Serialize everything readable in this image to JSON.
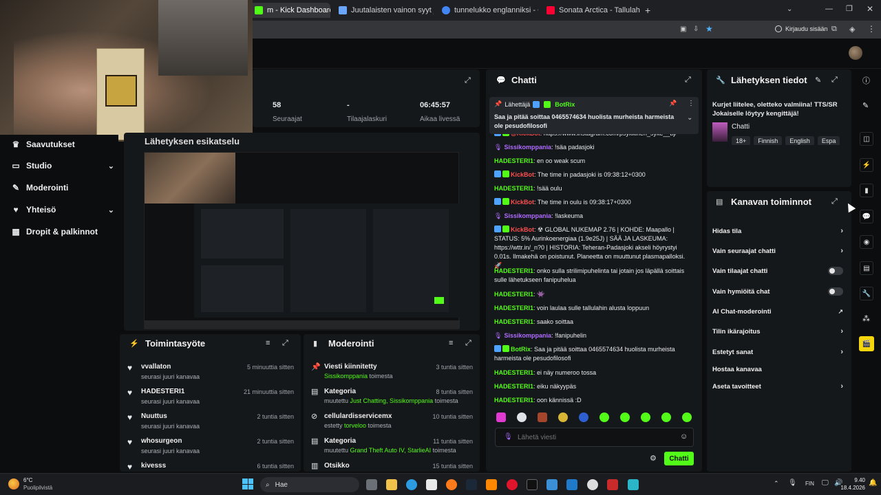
{
  "browser": {
    "tabs": [
      {
        "label": "m - Kick Dashboard",
        "color": "#53fc18"
      },
      {
        "label": "Juutalaisten vainon syyt ja aikaj",
        "color": "#6aa5ff"
      },
      {
        "label": "tunnelukko englanniksi - Googl",
        "color": "#4285f4"
      },
      {
        "label": "Sonata Arctica - Tallulah - YouT",
        "color": "#ff0033"
      }
    ],
    "signin_label": "Kirjaudu sisään"
  },
  "stats": [
    {
      "value": "58",
      "label": "Seuraajat"
    },
    {
      "value": "-",
      "label": "Tilaajalaskuri"
    },
    {
      "value": "06:45:57",
      "label": "Aikaa livessä"
    }
  ],
  "sidebar": {
    "items": [
      {
        "label": "Saavutukset",
        "icon": "trophy-icon"
      },
      {
        "label": "Studio",
        "icon": "studio-icon"
      },
      {
        "label": "Moderointi",
        "icon": "wrench-icon"
      },
      {
        "label": "Yhteisö",
        "icon": "community-icon"
      },
      {
        "label": "Dropit & palkinnot",
        "icon": "gift-icon"
      }
    ]
  },
  "preview": {
    "title": "Lähetyksen esikatselu"
  },
  "activity": {
    "title": "Toimintasyöte",
    "items": [
      {
        "name": "vvallaton",
        "sub": "seurasi juuri kanavaa",
        "time": "5 minuuttia sitten"
      },
      {
        "name": "HADESTERI1",
        "sub": "seurasi juuri kanavaa",
        "time": "21 minuuttia sitten"
      },
      {
        "name": "Nuuttus",
        "sub": "seurasi juuri kanavaa",
        "time": "2 tuntia sitten"
      },
      {
        "name": "whosurgeon",
        "sub": "seurasi juuri kanavaa",
        "time": "2 tuntia sitten"
      },
      {
        "name": "kivesss",
        "sub": "",
        "time": "6 tuntia sitten"
      }
    ]
  },
  "moderation": {
    "title": "Moderointi",
    "items": [
      {
        "name": "Viesti kiinnitetty",
        "sub_pre": "",
        "highlight": "Sissikomppania",
        "sub_post": " toimesta",
        "time": "3 tuntia sitten"
      },
      {
        "name": "Kategoria",
        "sub_pre": "muutettu ",
        "highlight": "Just Chatting, Sissikomppania",
        "sub_post": " toimesta",
        "time": "8 tuntia sitten"
      },
      {
        "name": "cellulardisservicemx",
        "sub_pre": "estetty ",
        "highlight": "torveloo",
        "sub_post": " toimesta",
        "time": "10 tuntia sitten"
      },
      {
        "name": "Kategoria",
        "sub_pre": "muutettu ",
        "highlight": "Grand Theft Auto IV, StarlieAI",
        "sub_post": " toimesta",
        "time": "11 tuntia sitten"
      },
      {
        "name": "Otsikko",
        "sub_pre": "",
        "highlight": "",
        "sub_post": "",
        "time": "15 tuntia sitten"
      }
    ]
  },
  "chat": {
    "title": "Chatti",
    "pinned_label": "Lähettäjä",
    "pinned_user": "BotRix",
    "pinned_text": "Saa ja pitää soittaa 0465574634 huolista murheista harmeista ole pesudofilosofi",
    "input_placeholder": "Lähetä viesti",
    "send_label": "Chatti",
    "messages": [
      {
        "user": "@KickBot",
        "cls": "red",
        "text": "https://www.instagram.com/psykkinen_syke__bj/"
      },
      {
        "user": "Sissikomppania",
        "cls": "purple",
        "text": "!säa padasjoki"
      },
      {
        "user": "HADESTERI1",
        "cls": "",
        "text": "en oo weak scum"
      },
      {
        "user": "KickBot",
        "cls": "red",
        "text": "The time in padasjoki is 09:38:12+0300"
      },
      {
        "user": "HADESTERI1",
        "cls": "",
        "text": "!sää oulu"
      },
      {
        "user": "KickBot",
        "cls": "red",
        "text": "The time in oulu is 09:38:17+0300"
      },
      {
        "user": "Sissikomppania",
        "cls": "purple",
        "text": "!laskeuma"
      },
      {
        "user": "KickBot",
        "cls": "red",
        "text": "☢ GLOBAL NUKEMAP 2.76 | KOHDE: Maapallo | STATUS: 5% Aurinkoenergiaa (1.9e25J) | SÄÄ JA LASKEUMA: https://wttr.in/_n?0 | HISTORIA: Teheran-Padasjoki akseli höyrystyi 0.01s. Ilmakehä on poistunut. Planeetta on muuttunut plasmapalloksi. 🚀"
      },
      {
        "user": "HADESTERI1",
        "cls": "",
        "text": "onko sulla strilimipuhelinta tai jotain jos läpällä soittais sulle lähetukseen fanipuhelua"
      },
      {
        "user": "HADESTERI1",
        "cls": "",
        "text": "👾"
      },
      {
        "user": "HADESTERI1",
        "cls": "",
        "text": "voin laulaa sulle tallulahin alusta loppuun"
      },
      {
        "user": "HADESTERI1",
        "cls": "",
        "text": "saako soittaa"
      },
      {
        "user": "Sissikomppania",
        "cls": "purple",
        "text": "!fanipuhelin"
      },
      {
        "user": "BotRix",
        "cls": "",
        "text": "Saa ja pitää soittaa 0465574634 huolista murheista harmeista ole pesudofilosofi"
      },
      {
        "user": "HADESTERI1",
        "cls": "",
        "text": "ei näy numeroo tossa"
      },
      {
        "user": "HADESTERI1",
        "cls": "",
        "text": "eiku näkyypäs"
      },
      {
        "user": "HADESTERI1",
        "cls": "",
        "text": "oon kännissä :D"
      }
    ]
  },
  "stream_info": {
    "title": "Lähetyksen tiedot",
    "description": "Kurjet liitelee, oletteko valmiina! TTS/SR Jokaiselle löytyy kengittäjä!",
    "category": "Chatti",
    "tags": [
      "18+",
      "Finnish",
      "English",
      "Espa"
    ]
  },
  "channel_actions": {
    "title": "Kanavan toiminnot",
    "items": [
      {
        "label": "Hidas tila",
        "kind": "chev"
      },
      {
        "label": "Vain seuraajat chatti",
        "kind": "chev"
      },
      {
        "label": "Vain tilaajat chatti",
        "kind": "toggle"
      },
      {
        "label": "Vain hymiöitä chat",
        "kind": "toggle"
      },
      {
        "label": "AI Chat-moderointi",
        "kind": "ext"
      },
      {
        "label": "Tilin ikärajoitus",
        "kind": "chev"
      },
      {
        "label": "Estetyt sanat",
        "kind": "chev"
      },
      {
        "label": "Hostaa kanavaa",
        "kind": "none"
      },
      {
        "label": "Aseta tavoitteet",
        "kind": "chev"
      }
    ]
  },
  "taskbar": {
    "weather_temp": "6°C",
    "weather_desc": "Puolipilvistä",
    "search_placeholder": "Hae",
    "lang": "FIN",
    "time": "9.40",
    "date": "18.4.2026"
  }
}
